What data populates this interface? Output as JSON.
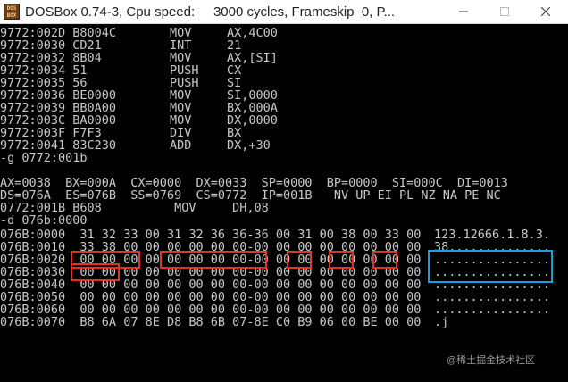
{
  "window": {
    "icon_text": "DOS\nBOX",
    "title": "DOSBox 0.74-3, Cpu speed:     3000 cycles, Frameskip  0, P..."
  },
  "console": {
    "lines": [
      {
        "addr": "9772:002D",
        "bytes": "B8004C",
        "op": "MOV",
        "args": "AX,4C00"
      },
      {
        "addr": "9772:0030",
        "bytes": "CD21",
        "op": "INT",
        "args": "21"
      },
      {
        "addr": "9772:0032",
        "bytes": "8B04",
        "op": "MOV",
        "args": "AX,[SI]"
      },
      {
        "addr": "9772:0034",
        "bytes": "51",
        "op": "PUSH",
        "args": "CX"
      },
      {
        "addr": "9772:0035",
        "bytes": "56",
        "op": "PUSH",
        "args": "SI"
      },
      {
        "addr": "9772:0036",
        "bytes": "BE0000",
        "op": "MOV",
        "args": "SI,0000"
      },
      {
        "addr": "9772:0039",
        "bytes": "BB0A00",
        "op": "MOV",
        "args": "BX,000A"
      },
      {
        "addr": "9772:003C",
        "bytes": "BA0000",
        "op": "MOV",
        "args": "DX,0000"
      },
      {
        "addr": "9772:003F",
        "bytes": "F7F3",
        "op": "DIV",
        "args": "BX"
      },
      {
        "addr": "9772:0041",
        "bytes": "83C230",
        "op": "ADD",
        "args": "DX,+30"
      }
    ],
    "cmd_g": "-g 0772:001b",
    "regs1": "AX=0038  BX=000A  CX=0000  DX=0033  SP=0000  BP=0000  SI=000C  DI=0013",
    "regs2": "DS=076A  ES=076B  SS=0769  CS=0772  IP=001B   NV UP EI PL NZ NA PE NC",
    "regs3": "0772:001B B608          MOV     DH,08",
    "cmd_d": "-d 076b:0000",
    "dump": [
      {
        "addr": "076B:0000",
        "hex": "31 32 33 00 31 32 36 36-36 00 31 00 38 00 33 00",
        "ascii": "123.12666.1.8.3."
      },
      {
        "addr": "076B:0010",
        "hex": "33 38 00 00 00 00 00 00-00 00 00 00 00 00 00 00",
        "ascii": "38.............."
      },
      {
        "addr": "076B:0020",
        "hex": "00 00 00 00 00 00 00 00-00 00 00 00 00 00 00 00",
        "ascii": "................"
      },
      {
        "addr": "076B:0030",
        "hex": "00 00 00 00 00 00 00 00-00 00 00 00 00 00 00 00",
        "ascii": "................"
      },
      {
        "addr": "076B:0040",
        "hex": "00 00 00 00 00 00 00 00-00 00 00 00 00 00 00 00",
        "ascii": "................"
      },
      {
        "addr": "076B:0050",
        "hex": "00 00 00 00 00 00 00 00-00 00 00 00 00 00 00 00",
        "ascii": "................"
      },
      {
        "addr": "076B:0060",
        "hex": "00 00 00 00 00 00 00 00-00 00 00 00 00 00 00 00",
        "ascii": "................"
      },
      {
        "addr": "076B:0070",
        "hex": "B8 6A 07 8E D8 B8 6B 07-8E C0 B9 06 00 BE 00 00",
        "ascii": ".j"
      }
    ]
  },
  "watermark": "@稀土掘金技术社区",
  "colors": {
    "red_box": "#e8321e",
    "blue_box": "#19a0dc",
    "console_text": "#c8c8c8"
  }
}
